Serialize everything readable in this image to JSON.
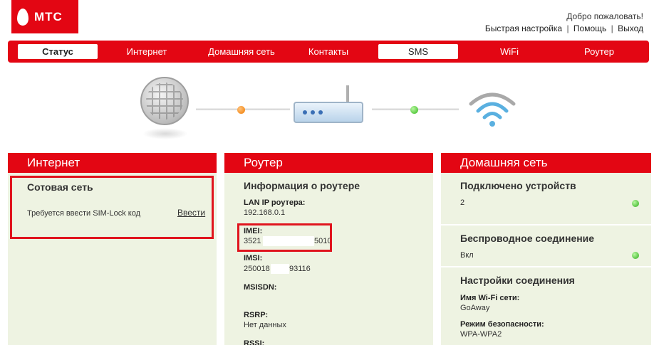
{
  "logo": {
    "text": "МТС"
  },
  "header": {
    "welcome": "Добро пожаловать!",
    "links": [
      "Быстрая настройка",
      "Помощь",
      "Выход"
    ],
    "separator": "|"
  },
  "nav": {
    "items": [
      "Статус",
      "Интернет",
      "Домашняя сеть",
      "Контакты",
      "SMS",
      "WiFi",
      "Роутер"
    ]
  },
  "colors": {
    "brand": "#e30613",
    "panel_bg": "#eef3e2",
    "ok": "#34b81c",
    "warn": "#f07a00"
  },
  "internet": {
    "title": "Интернет",
    "section": "Сотовая сеть",
    "message": "Требуется ввести SIM-Lock код",
    "action": "Ввести"
  },
  "router": {
    "title": "Роутер",
    "section": "Информация о роутере",
    "lan_ip_label": "LAN IP роутера:",
    "lan_ip": "192.168.0.1",
    "imei_label": "IMEI:",
    "imei_start": "3521",
    "imei_end": "5010",
    "imsi_label": "IMSI:",
    "imsi_start": "250018",
    "imsi_end": "93116",
    "msisdn_label": "MSISDN:",
    "rsrp_label": "RSRP:",
    "rsrp_value": "Нет данных",
    "rssi_label": "RSSI:"
  },
  "home": {
    "title": "Домашняя сеть",
    "connected_title": "Подключено устройств",
    "connected_value": "2",
    "wireless_title": "Беспроводное соединение",
    "wireless_value": "Вкл",
    "settings_title": "Настройки соединения",
    "wifi_name_label": "Имя Wi-Fi сети:",
    "wifi_name": "GoAway",
    "security_label": "Режим безопасности:",
    "security_value": "WPA-WPA2"
  }
}
